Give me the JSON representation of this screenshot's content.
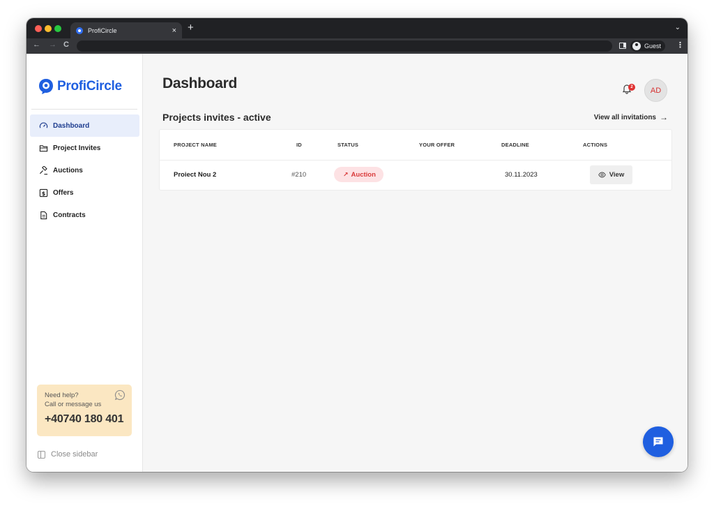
{
  "browser": {
    "tab_title": "ProfiCircle",
    "tab_close": "×",
    "new_tab": "+",
    "tabs_menu": "⌄",
    "back": "←",
    "forward": "→",
    "reload": "C",
    "profile_label": "Guest",
    "menu": "⋮"
  },
  "brand": {
    "name": "ProfiCircle",
    "color": "#1f5fe0"
  },
  "sidebar": {
    "items": [
      {
        "label": "Dashboard",
        "icon": "gauge-icon",
        "active": true
      },
      {
        "label": "Project Invites",
        "icon": "folder-icon"
      },
      {
        "label": "Auctions",
        "icon": "gavel-icon"
      },
      {
        "label": "Offers",
        "icon": "dollar-icon"
      },
      {
        "label": "Contracts",
        "icon": "document-icon"
      }
    ],
    "help": {
      "title": "Need help?",
      "subtitle": "Call or message us",
      "phone": "+40740 180 401",
      "icon": "whatsapp-icon"
    },
    "close_label": "Close sidebar"
  },
  "header": {
    "title": "Dashboard",
    "notification_count": "2",
    "avatar_initials": "AD"
  },
  "invites": {
    "title": "Projects invites - active",
    "view_all": "View all invitations",
    "view_all_arrow": "→",
    "columns": [
      "PROJECT NAME",
      "ID",
      "STATUS",
      "YOUR OFFER",
      "DEADLINE",
      "ACTIONS"
    ],
    "rows": [
      {
        "name": "Proiect Nou 2",
        "id": "#210",
        "status": "Auction",
        "status_icon": "↗",
        "offer": "",
        "deadline": "30.11.2023",
        "action": "View"
      }
    ]
  },
  "colors": {
    "accent": "#1f5fe0",
    "status_auction_bg": "#fde2e4",
    "status_auction_text": "#d93a3a",
    "help_bg": "#fbe7c2"
  }
}
